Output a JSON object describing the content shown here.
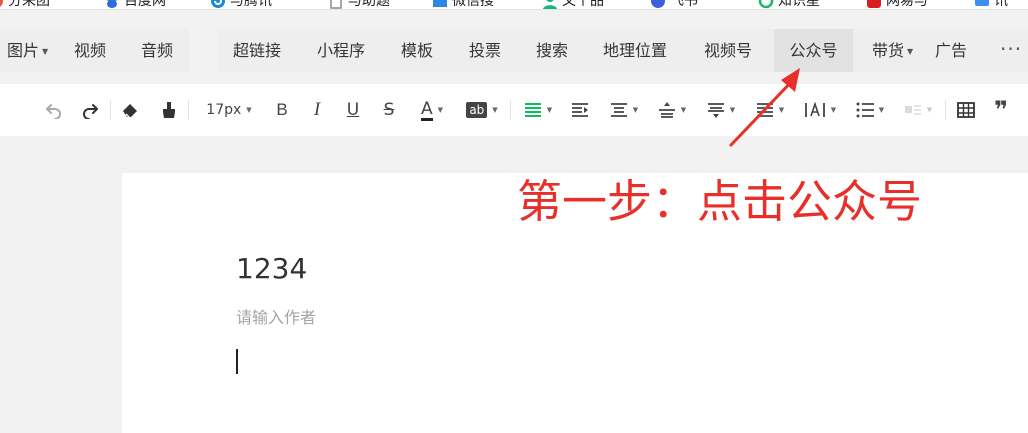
{
  "bookmarks": [
    {
      "label": "分采团",
      "icon": "app-icon",
      "color": "#e45a3d"
    },
    {
      "label": "百度网",
      "icon": "baidu-icon",
      "color": "#2d6cdf"
    },
    {
      "label": "与腾讯",
      "icon": "refresh-icon",
      "color": "#1a8ad8"
    },
    {
      "label": "与助题",
      "icon": "page-icon",
      "color": "#9e9e9e"
    },
    {
      "label": "微信搜",
      "icon": "folder-icon",
      "color": "#2b86e8"
    },
    {
      "label": "又个品",
      "icon": "user-icon",
      "color": "#14b879"
    },
    {
      "label": "飞书",
      "icon": "feishu-icon",
      "color": "#3c5fe0"
    },
    {
      "label": "知识星",
      "icon": "planet-icon",
      "color": "#1bb46b"
    },
    {
      "label": "网易与",
      "icon": "netease-icon",
      "color": "#d81e1e"
    },
    {
      "label": "讯",
      "icon": "chat-icon",
      "color": "#3d8ef0"
    }
  ],
  "insert_menu": {
    "left_items": [
      {
        "label": "图片",
        "dropdown": true
      },
      {
        "label": "视频",
        "dropdown": false
      },
      {
        "label": "音频",
        "dropdown": false
      }
    ],
    "right_items": [
      {
        "label": "超链接",
        "dropdown": false
      },
      {
        "label": "小程序",
        "dropdown": false
      },
      {
        "label": "模板",
        "dropdown": false
      },
      {
        "label": "投票",
        "dropdown": false
      },
      {
        "label": "搜索",
        "dropdown": false
      },
      {
        "label": "地理位置",
        "dropdown": false
      },
      {
        "label": "视频号",
        "dropdown": false
      },
      {
        "label": "公众号",
        "dropdown": false,
        "active": true
      },
      {
        "label": "带货",
        "dropdown": true
      },
      {
        "label": "广告",
        "dropdown": false
      }
    ],
    "more": "···"
  },
  "toolbar": {
    "font_size": "17px",
    "accent_color": "#07c160",
    "buttons": [
      "undo-icon",
      "redo-icon",
      "eraser-icon",
      "format-painter-icon",
      "font-size-select",
      "bold-icon",
      "italic-icon",
      "underline-icon",
      "strikethrough-icon",
      "font-color-icon",
      "background-color-icon",
      "align-icon",
      "indent-icon",
      "line-height-icon",
      "paragraph-spacing-top-icon",
      "paragraph-spacing-bottom-icon",
      "letter-spacing-icon",
      "list-icon",
      "table-icon",
      "quote-icon"
    ],
    "labels": {
      "bold": "B",
      "italic": "I",
      "underline": "U",
      "strike": "S",
      "font_color": "A",
      "bg_color": "ab",
      "quote": "❞"
    }
  },
  "document": {
    "title": "1234",
    "author_placeholder": "请输入作者"
  },
  "annotation": {
    "text": "第一步：点击公众号",
    "color": "#e8302a"
  }
}
